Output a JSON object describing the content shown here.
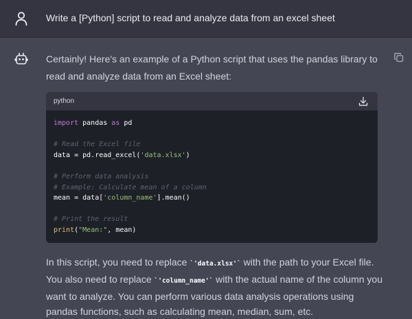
{
  "user_message": {
    "icon": "user-icon",
    "text": "Write a [Python] script to read and analyze data from an excel sheet"
  },
  "assistant_message": {
    "icon": "bot-icon",
    "copy_icon": "copy-icon",
    "intro": "Certainly! Here's an example of a Python script that uses the pandas library to read and analyze data from an Excel sheet:",
    "code_block": {
      "language": "python",
      "download_icon": "download-icon",
      "line1_kw1": "import",
      "line1_mid": " pandas ",
      "line1_kw2": "as",
      "line1_end": " pd",
      "line2_comment": "# Read the Excel file",
      "line3_pre": "data = pd.read_excel(",
      "line3_str": "'data.xlsx'",
      "line3_post": ")",
      "line4_comment": "# Perform data analysis",
      "line5_comment": "# Example: Calculate mean of a column",
      "line6_pre": "mean = data[",
      "line6_str": "'column_name'",
      "line6_post": "].mean()",
      "line7_comment": "# Print the result",
      "line8_fn": "print",
      "line8_open": "(",
      "line8_str": "\"Mean:\"",
      "line8_post": ", mean)"
    },
    "outro": {
      "part1": "In this script, you need to replace ",
      "code1": "`'data.xlsx'`",
      "part2": " with the path to your Excel file. You also need to replace ",
      "code2": "`'column_name'`",
      "part3": " with the actual name of the column you want to analyze. You can perform various data analysis operations using pandas functions, such as calculating mean, median, sum, etc."
    }
  }
}
